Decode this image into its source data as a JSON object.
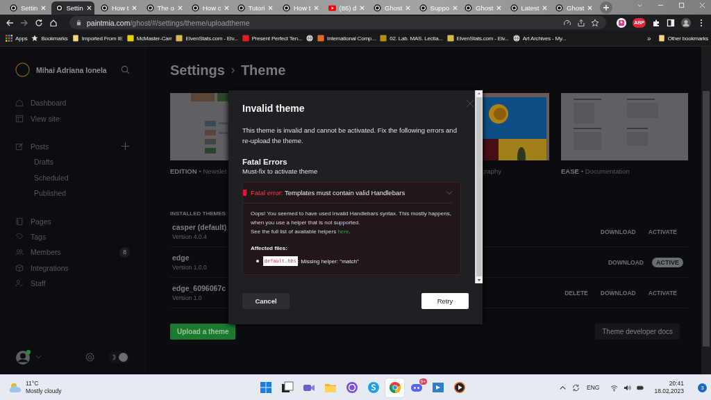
{
  "browser": {
    "tabs": [
      {
        "title": "Settin",
        "kind": "ring",
        "selected": false
      },
      {
        "title": "Settin",
        "kind": "ring",
        "selected": true
      },
      {
        "title": "How t",
        "kind": "ring",
        "selected": false
      },
      {
        "title": "The o",
        "kind": "ring",
        "selected": false
      },
      {
        "title": "How c",
        "kind": "ring",
        "selected": false
      },
      {
        "title": "Tutori",
        "kind": "ring",
        "selected": false
      },
      {
        "title": "How t",
        "kind": "ring",
        "selected": false
      },
      {
        "title": "(86) d",
        "kind": "video",
        "selected": false
      },
      {
        "title": "Ghost",
        "kind": "ring",
        "selected": false
      },
      {
        "title": "Suppo",
        "kind": "ring",
        "selected": false
      },
      {
        "title": "Ghost",
        "kind": "ring",
        "selected": false
      },
      {
        "title": "Latest",
        "kind": "ring",
        "selected": false
      },
      {
        "title": "Ghost",
        "kind": "ring",
        "selected": false
      }
    ],
    "address": {
      "host": "paintmia.com",
      "path": "/ghost/#/settings/theme/uploadtheme"
    },
    "extension_label": "ABP",
    "bookmarks": [
      {
        "label": "Apps",
        "kind": "apps"
      },
      {
        "label": "Bookmarks",
        "kind": "star"
      },
      {
        "label": "Imported From IE",
        "kind": "folder"
      },
      {
        "label": "McMaster-Carr",
        "kind": "favicon",
        "color": "#e8d000"
      },
      {
        "label": "ElvenStats.com - Elv...",
        "kind": "favicon",
        "color": "#d8b848"
      },
      {
        "label": "Present Perfect Ten...",
        "kind": "favicon",
        "color": "#e02020"
      },
      {
        "kind": "globe"
      },
      {
        "label": "International Comp...",
        "kind": "favicon",
        "color": "#e06a20"
      },
      {
        "label": "02. Lab. MAS. Lectia...",
        "kind": "favicon",
        "color": "#b88a18"
      },
      {
        "label": "ElvenStats.com - Elv...",
        "kind": "favicon",
        "color": "#d8b848"
      },
      {
        "label": "Art Archives - My...",
        "kind": "globe"
      }
    ],
    "more_bookmarks": "»",
    "other_bookmarks": "Other bookmarks"
  },
  "sidebar": {
    "user": "Mihai Adriana Ionela",
    "groups": [
      {
        "items": [
          {
            "label": "Dashboard",
            "kind": "home"
          },
          {
            "label": "View site",
            "kind": "layout"
          }
        ]
      },
      {
        "items": [
          {
            "label": "Posts",
            "kind": "edit",
            "add": true,
            "children": [
              {
                "label": "Drafts"
              },
              {
                "label": "Scheduled"
              },
              {
                "label": "Published"
              }
            ]
          }
        ]
      },
      {
        "items": [
          {
            "label": "Pages",
            "kind": "page"
          },
          {
            "label": "Tags",
            "kind": "tag"
          },
          {
            "label": "Members",
            "kind": "members",
            "badge": "8"
          },
          {
            "label": "Integrations",
            "kind": "box"
          },
          {
            "label": "Staff",
            "kind": "staff"
          }
        ]
      }
    ],
    "theme_toggle": {
      "on": true
    }
  },
  "page": {
    "breadcrumb": [
      "Settings",
      "Theme"
    ],
    "themes": [
      {
        "name": "EDITION",
        "desc": "• Newslet",
        "kind": "site"
      },
      {
        "desc": "graphy"
      },
      {
        "name": "EASE",
        "desc": "• Documentation",
        "kind": "doc"
      }
    ],
    "installed_title": "INSTALLED THEMES",
    "installed": [
      {
        "name": "casper (default)",
        "version": "Version 4.0.4",
        "actions": [
          {
            "label": "DOWNLOAD",
            "kind": "link"
          },
          {
            "label": "ACTIVATE",
            "kind": "link"
          }
        ]
      },
      {
        "name": "edge",
        "version": "Version 1.0.0",
        "actions": [
          {
            "label": "DOWNLOAD",
            "kind": "link"
          },
          {
            "label": "ACTIVE",
            "kind": "badge"
          }
        ]
      },
      {
        "name": "edge_6096067c",
        "version": "Version 1.0",
        "actions": [
          {
            "label": "DELETE",
            "kind": "link"
          },
          {
            "label": "DOWNLOAD",
            "kind": "link"
          },
          {
            "label": "ACTIVATE",
            "kind": "link"
          }
        ]
      }
    ],
    "upload_button": "Upload a theme",
    "docs_button": "Theme developer docs"
  },
  "modal": {
    "title": "Invalid theme",
    "intro": "This theme is invalid and cannot be activated. Fix the following errors and re-upload the theme.",
    "section_title": "Fatal Errors",
    "section_subtitle": "Must-fix to activate theme",
    "errors": [
      {
        "label": "Fatal error:",
        "message": "Templates must contain valid Handlebars",
        "expanded": true,
        "body": [
          "Oops! You seemed to have used invalid Handlebars syntax. This mostly happens, when you use a helper that is not supported.",
          "See the full list of available helpers"
        ],
        "link": "here",
        "link_after": ".",
        "files_title": "Affected files:",
        "files": [
          {
            "file": "default.hbs",
            "note": ": Missing helper: \"match\""
          }
        ]
      }
    ],
    "cancel": "Cancel",
    "retry": "Retry"
  },
  "taskbar": {
    "temperature": "11°C",
    "weather": "Mostly cloudy",
    "apps": [
      {
        "kind": "start",
        "selected": false
      },
      {
        "kind": "taskview",
        "selected": false
      },
      {
        "kind": "camera",
        "selected": false
      },
      {
        "kind": "folder",
        "selected": false
      },
      {
        "kind": "ring",
        "selected": false
      },
      {
        "kind": "chat",
        "selected": false
      },
      {
        "kind": "browser",
        "selected": true
      },
      {
        "kind": "controller",
        "selected": false,
        "badge": "9+"
      },
      {
        "kind": "window",
        "selected": false
      },
      {
        "kind": "play",
        "selected": false
      }
    ],
    "language": "ENG",
    "time": "20:41",
    "date": "18.02.2023",
    "notifications": "3"
  }
}
